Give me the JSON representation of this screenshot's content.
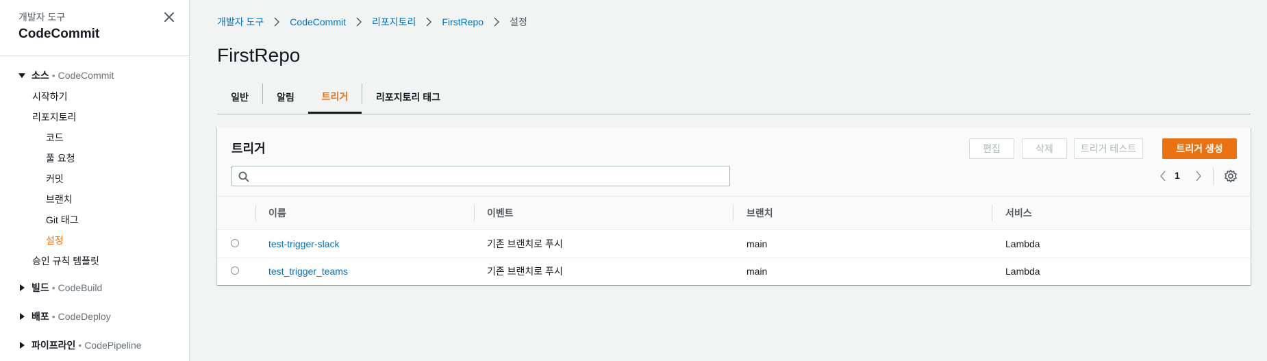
{
  "sidebar": {
    "subtitle": "개발자 도구",
    "title": "CodeCommit",
    "source_group": {
      "name": "소스",
      "service": "CodeCommit"
    },
    "items": [
      {
        "label": "시작하기"
      },
      {
        "label": "리포지토리"
      },
      {
        "label": "코드"
      },
      {
        "label": "풀 요청"
      },
      {
        "label": "커밋"
      },
      {
        "label": "브랜치"
      },
      {
        "label": "Git 태그"
      },
      {
        "label": "설정"
      },
      {
        "label": "승인 규칙 템플릿"
      }
    ],
    "groups": [
      {
        "name": "빌드",
        "service": "CodeBuild"
      },
      {
        "name": "배포",
        "service": "CodeDeploy"
      },
      {
        "name": "파이프라인",
        "service": "CodePipeline"
      }
    ]
  },
  "breadcrumb": {
    "items": [
      "개발자 도구",
      "CodeCommit",
      "리포지토리",
      "FirstRepo"
    ],
    "current": "설정"
  },
  "page": {
    "title": "FirstRepo"
  },
  "tabs": [
    {
      "label": "일반"
    },
    {
      "label": "알림"
    },
    {
      "label": "트리거"
    },
    {
      "label": "리포지토리 태그"
    }
  ],
  "panel": {
    "title": "트리거",
    "buttons": {
      "edit": "편집",
      "delete": "삭제",
      "test": "트리거 테스트",
      "create": "트리거 생성"
    },
    "search": {
      "value": "",
      "placeholder": ""
    },
    "pagination": {
      "page": "1"
    },
    "columns": [
      "이름",
      "이벤트",
      "브랜치",
      "서비스"
    ],
    "rows": [
      {
        "name": "test-trigger-slack",
        "event": "기존 브랜치로 푸시",
        "branch": "main",
        "service": "Lambda"
      },
      {
        "name": "test_trigger_teams",
        "event": "기존 브랜치로 푸시",
        "branch": "main",
        "service": "Lambda"
      }
    ]
  },
  "colors": {
    "accent": "#ec7211",
    "link": "#0073bb",
    "text": "#16191f",
    "background": "#f2f3f3"
  },
  "icons": [
    "close-icon",
    "caret-down-icon",
    "caret-right-icon",
    "chevron-right-icon",
    "search-icon",
    "chevron-left-icon",
    "gear-icon"
  ]
}
